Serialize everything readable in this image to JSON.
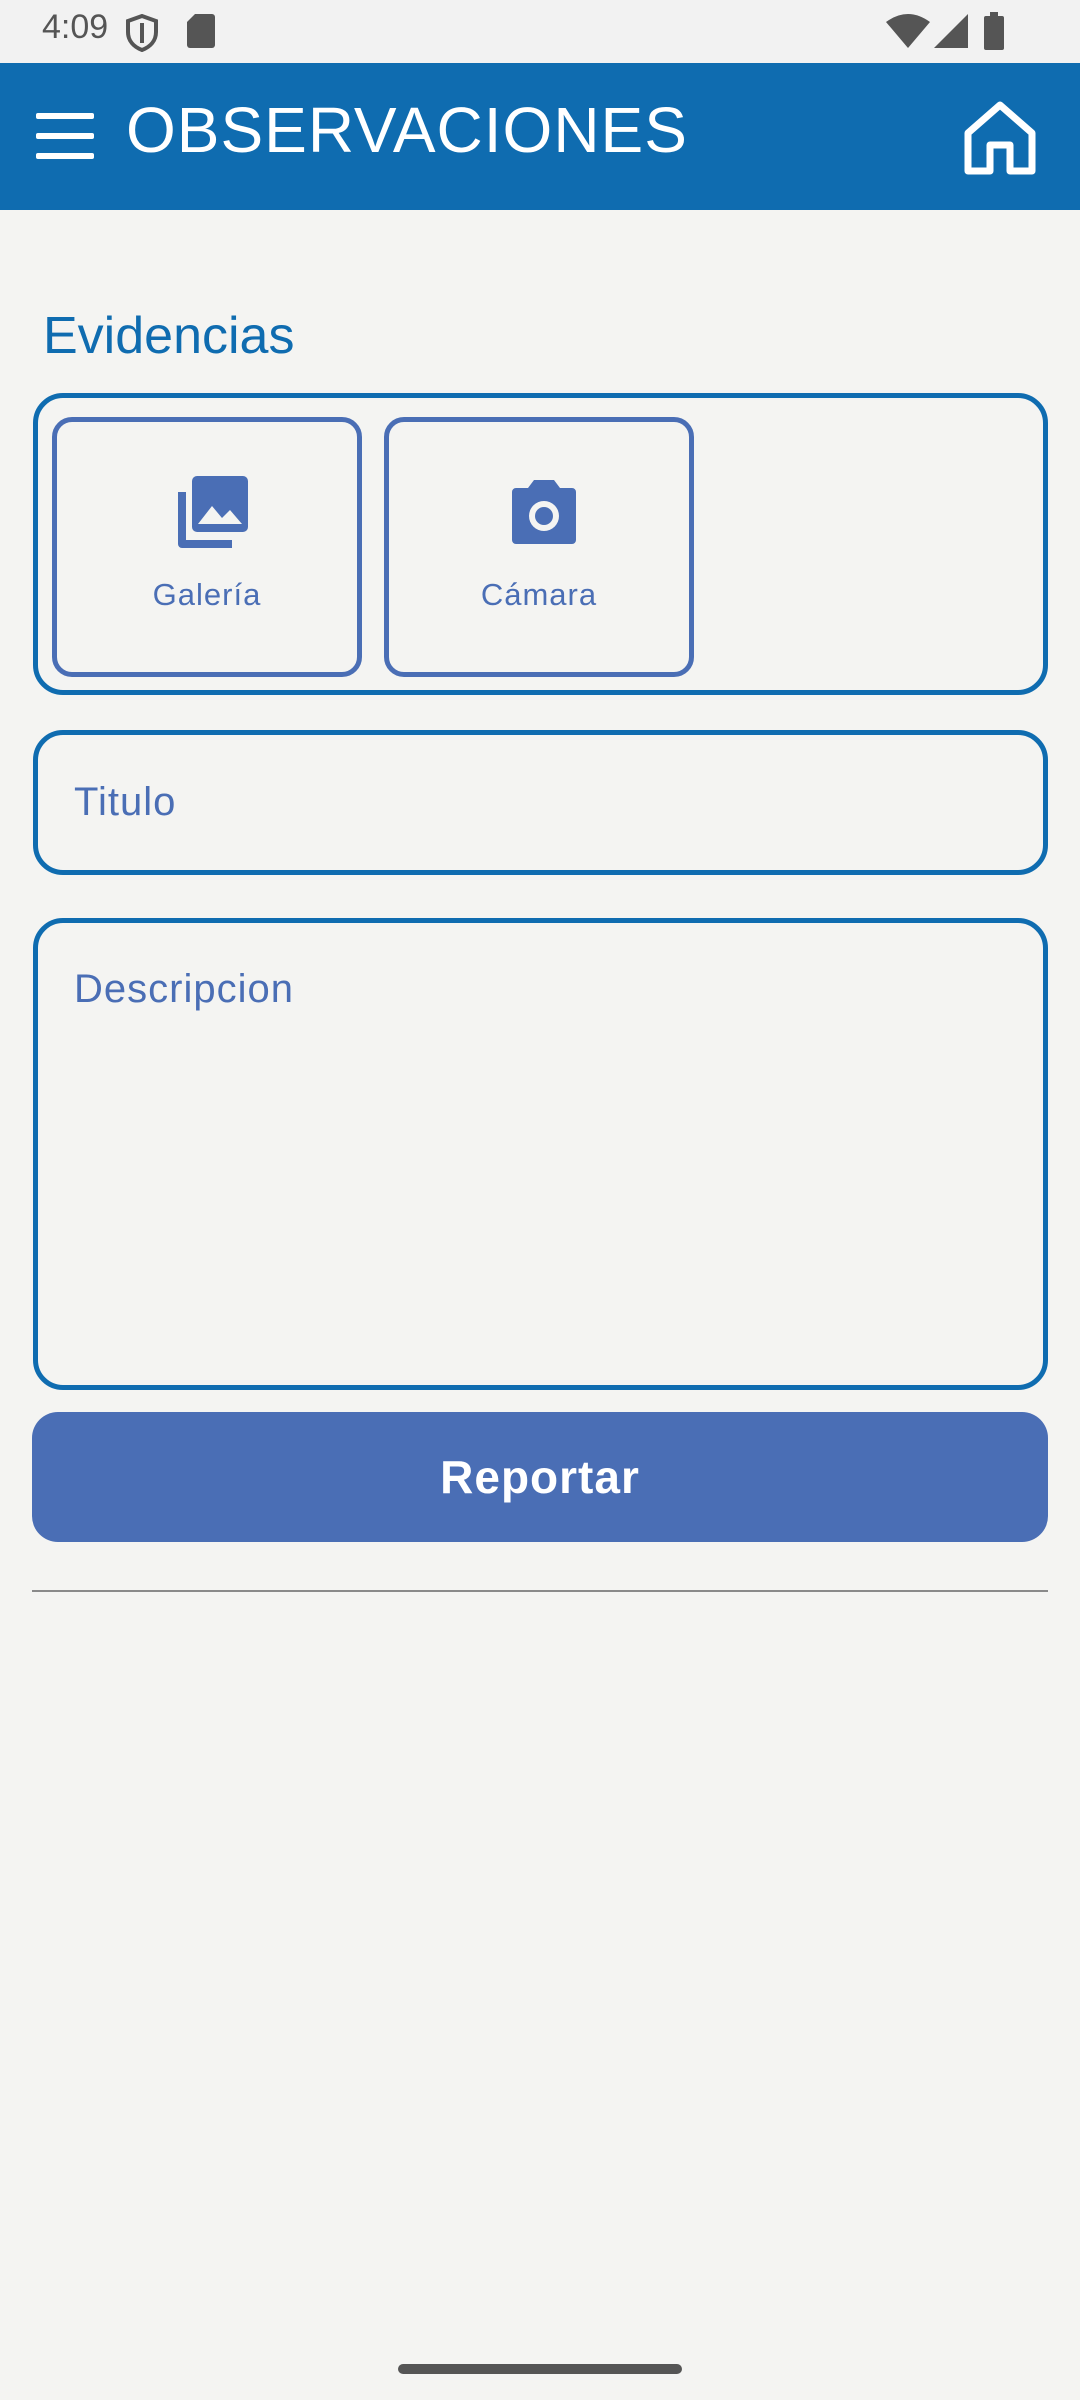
{
  "status_bar": {
    "time": "4:09",
    "icons": [
      "shield-icon",
      "sd-card-icon",
      "wifi-icon",
      "cell-signal-icon",
      "battery-icon"
    ]
  },
  "app_bar": {
    "title": "OBSERVACIONES",
    "menu_icon": "hamburger-menu-icon",
    "home_icon": "home-icon",
    "background": "#0f6cb0"
  },
  "form": {
    "evidence_label": "Evidencias",
    "evidence_buttons": [
      {
        "label": "Galería",
        "icon": "gallery-icon"
      },
      {
        "label": "Cámara",
        "icon": "camera-icon"
      }
    ],
    "title_placeholder": "Titulo",
    "description_placeholder": "Descripcion",
    "submit_label": "Reportar"
  },
  "colors": {
    "primary": "#0f6cb0",
    "accent": "#4a6eb5",
    "background": "#f4f4f2"
  }
}
